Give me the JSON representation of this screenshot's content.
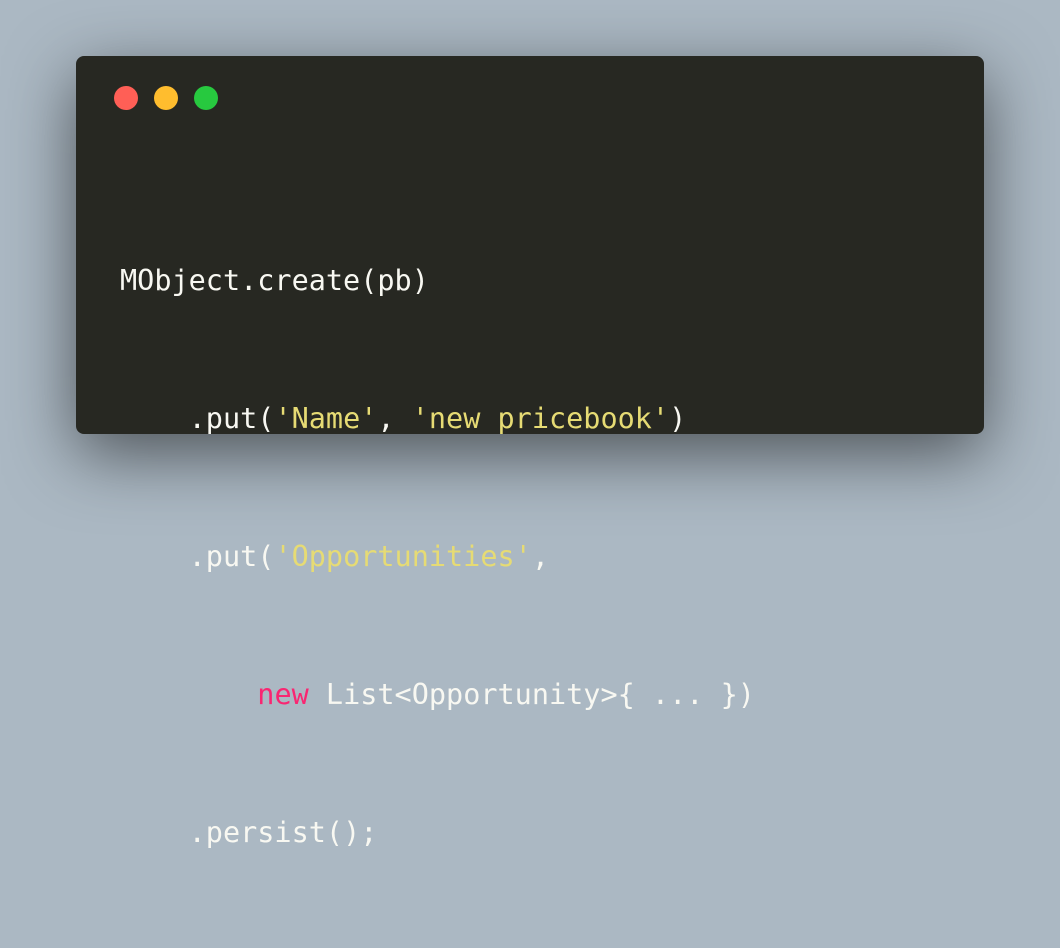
{
  "colors": {
    "background": "#abb8c3",
    "editor_background": "#272822",
    "text": "#f8f8f2",
    "string": "#e6db74",
    "keyword": "#f92672",
    "close_dot": "#ff5f56",
    "minimize_dot": "#ffbd2e",
    "maximize_dot": "#27c93f"
  },
  "window_controls": [
    "close",
    "minimize",
    "maximize"
  ],
  "code": {
    "line1": {
      "text": "MObject.create(pb)"
    },
    "line2": {
      "indent": "    ",
      "prefix": ".put(",
      "str1": "'Name'",
      "sep": ", ",
      "str2": "'new pricebook'",
      "suffix": ")"
    },
    "line3": {
      "indent": "    ",
      "prefix": ".put(",
      "str1": "'Opportunities'",
      "suffix": ","
    },
    "line4": {
      "indent": "        ",
      "keyword": "new",
      "rest": " List<Opportunity>{ ... })"
    },
    "line5": {
      "indent": "    ",
      "text": ".persist();"
    }
  }
}
